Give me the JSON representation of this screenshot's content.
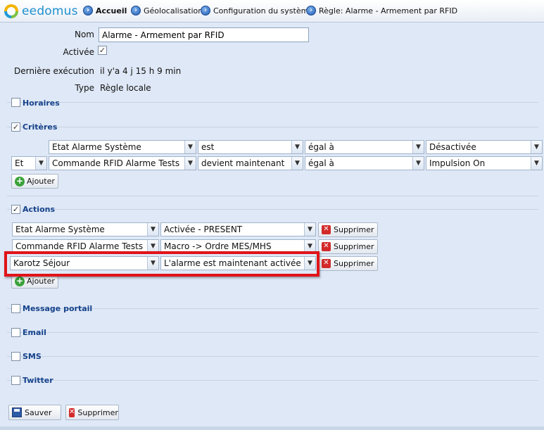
{
  "header": {
    "logo_text": "eedomus",
    "breadcrumbs": [
      {
        "label": "Accueil"
      },
      {
        "label": "Géolocalisation"
      },
      {
        "label": "Configuration du système"
      },
      {
        "label": "Règle: Alarme - Armement par RFID"
      }
    ]
  },
  "form": {
    "nom_label": "Nom",
    "nom_value": "Alarme - Armement par RFID",
    "activee_label": "Activée",
    "activee_checked": true,
    "derniere_label": "Dernière exécution",
    "derniere_value": "il y'a 4 j 15 h 9 min",
    "type_label": "Type",
    "type_value": "Règle locale"
  },
  "sections": {
    "horaires": {
      "title": "Horaires",
      "checked": false
    },
    "criteres": {
      "title": "Critères",
      "checked": true
    },
    "actions": {
      "title": "Actions",
      "checked": true
    },
    "message_portail": {
      "title": "Message portail",
      "checked": false
    },
    "email": {
      "title": "Email",
      "checked": false
    },
    "sms": {
      "title": "SMS",
      "checked": false
    },
    "twitter": {
      "title": "Twitter",
      "checked": false
    }
  },
  "criteria": [
    {
      "connector": "",
      "device": "Etat Alarme Système",
      "condition": "est",
      "operator": "égal à",
      "value": "Désactivée"
    },
    {
      "connector": "Et",
      "device": "Commande RFID Alarme Tests",
      "condition": "devient maintenant",
      "operator": "égal à",
      "value": "Impulsion On"
    }
  ],
  "actions": [
    {
      "device": "Etat Alarme Système",
      "value": "Activée - PRESENT",
      "delete_label": "Supprimer"
    },
    {
      "device": "Commande RFID Alarme Tests",
      "value": "Macro -> Ordre MES/MHS",
      "delete_label": "Supprimer"
    },
    {
      "device": "Karotz Séjour",
      "value": "L'alarme est maintenant activée !",
      "delete_label": "Supprimer"
    }
  ],
  "buttons": {
    "add_label": "Ajouter",
    "save_label": "Sauver",
    "delete_label": "Supprimer"
  },
  "colors": {
    "highlight": "#e0141a",
    "section_title": "#15428b",
    "background": "#dfe8f6"
  }
}
